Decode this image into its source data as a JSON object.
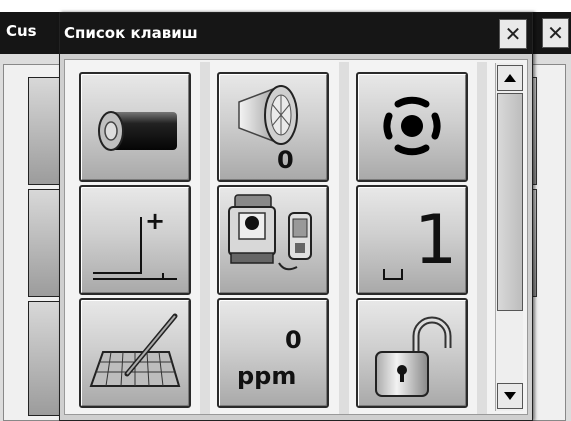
{
  "background_window": {
    "title": "Cus",
    "close_glyph": "✕"
  },
  "dialog": {
    "title": "Список клавиш",
    "close_glyph": "✕"
  },
  "keys": [
    {
      "id": "battery",
      "icon": "battery-icon"
    },
    {
      "id": "prism-constant",
      "icon": "prism-icon",
      "value": "0"
    },
    {
      "id": "laser-pointer",
      "icon": "target-icon"
    },
    {
      "id": "offset-height",
      "icon": "height-offset-icon",
      "mark": "+"
    },
    {
      "id": "instrument-connection",
      "icon": "total-station-icon"
    },
    {
      "id": "character-entry",
      "icon": "space-one-icon",
      "char": "1"
    },
    {
      "id": "keyboard-input",
      "icon": "keyboard-pen-icon"
    },
    {
      "id": "atmospheric-correction",
      "icon": "ppm-icon",
      "value": "0",
      "unit": "ppm"
    },
    {
      "id": "unlock",
      "icon": "padlock-open-icon"
    }
  ],
  "scrollbar": {
    "up_glyph": "▲",
    "down_glyph": "▼",
    "thumb_fraction": 0.75
  }
}
